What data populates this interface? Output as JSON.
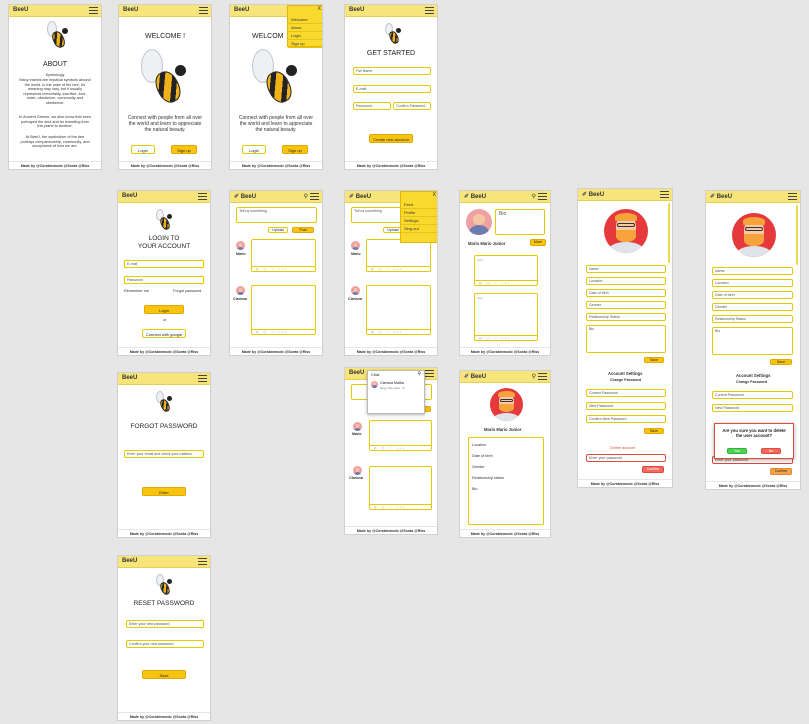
{
  "brand": "BeeU",
  "footer": "Made by @Corabiemodo @Sonta @Riss",
  "about": {
    "title": "ABOUT",
    "p1": "Symbology",
    "p2": "Many insects are mystical symbols around the world. In the case of the bee, it's meaning may vary, but it usually represents immortality, sacrifice, love, order, obedience, community and obedience.",
    "p3": "In Ancient Greece, we also know that bees portrayed the soul and for travelling from this plane to another.",
    "p4": "At BeeU, the symbolism of the bee portrays companionship, community, and acceptance of how we are."
  },
  "welcome": {
    "title": "WELCOME !",
    "text": "Connect with people from all over the world and learn to appreciate the natural beauty.",
    "login": "Login",
    "signup": "Sign up"
  },
  "welcome_menu": {
    "title": "WELCOM",
    "close": "X",
    "items": [
      "Welcome",
      "About",
      "Login",
      "Sign up"
    ]
  },
  "get_started": {
    "title": "GET STARTED",
    "fullname": "Full Name",
    "email": "E-mail",
    "password": "Password",
    "confirm": "Confirm Password",
    "create": "Create new account"
  },
  "login": {
    "title1": "LOGIN TO",
    "title2": "YOUR ACCOUNT",
    "email": "E-mail",
    "password": "Password",
    "remember": "Remember me",
    "forgot": "Forgot password",
    "login": "Login",
    "or": "or",
    "google": "Connect with google"
  },
  "feed": {
    "placeholder": "Tell us something",
    "upload": "Upload",
    "post": "Post",
    "user1": "Mario",
    "user2": "Clarissa",
    "icons": "◎ ▢ ♡  •••"
  },
  "feed_menu": {
    "close": "X",
    "items": [
      "Feed",
      "Profile",
      "Settings",
      "Sing out"
    ]
  },
  "chat": {
    "header": "Chat",
    "contact": "Clarissa Mattia",
    "preview": "Heyy, like Here : P"
  },
  "profile": {
    "name": "Mario Mario Junior",
    "bio": "Bio",
    "more": "More",
    "post1": "cool",
    "post2": "cool"
  },
  "profile_info": {
    "name": "Mario Mario Junior",
    "fields": [
      "Location",
      "Date of birth",
      "Gender",
      "Relationship status",
      "Bio"
    ]
  },
  "settings": {
    "fields": [
      "Name",
      "Location",
      "Date of birth",
      "Gender",
      "Relationship Status",
      "Bio"
    ],
    "save": "Save",
    "account": "Account Settings",
    "change": "Change Password",
    "current": "Current Password",
    "new": "New Password",
    "confirm": "Confirm New Password",
    "delete_title": "Delete account",
    "delete_input": "Enter your password",
    "confirm_btn": "Confirm"
  },
  "settings_modal": {
    "fields": [
      "Name",
      "Location",
      "Date of birth",
      "Gender",
      "Relationship Status",
      "Bio"
    ],
    "save": "Save",
    "account": "Account Settings",
    "change": "Change Password",
    "current": "Current Password",
    "new": "New Password",
    "question": "Are you sure you want to delete the user account?",
    "yes": "Yes",
    "no": "No",
    "behind": "Enter your password",
    "confirm_btn": "Confirm"
  },
  "forgot": {
    "title": "FORGOT PASSWORD",
    "email": "Enter your email and check your mailbox",
    "enter": "Enter"
  },
  "reset": {
    "title": "RESET PASSWORD",
    "new": "Enter your new password",
    "confirm": "Confirm your new password",
    "save": "Save"
  }
}
